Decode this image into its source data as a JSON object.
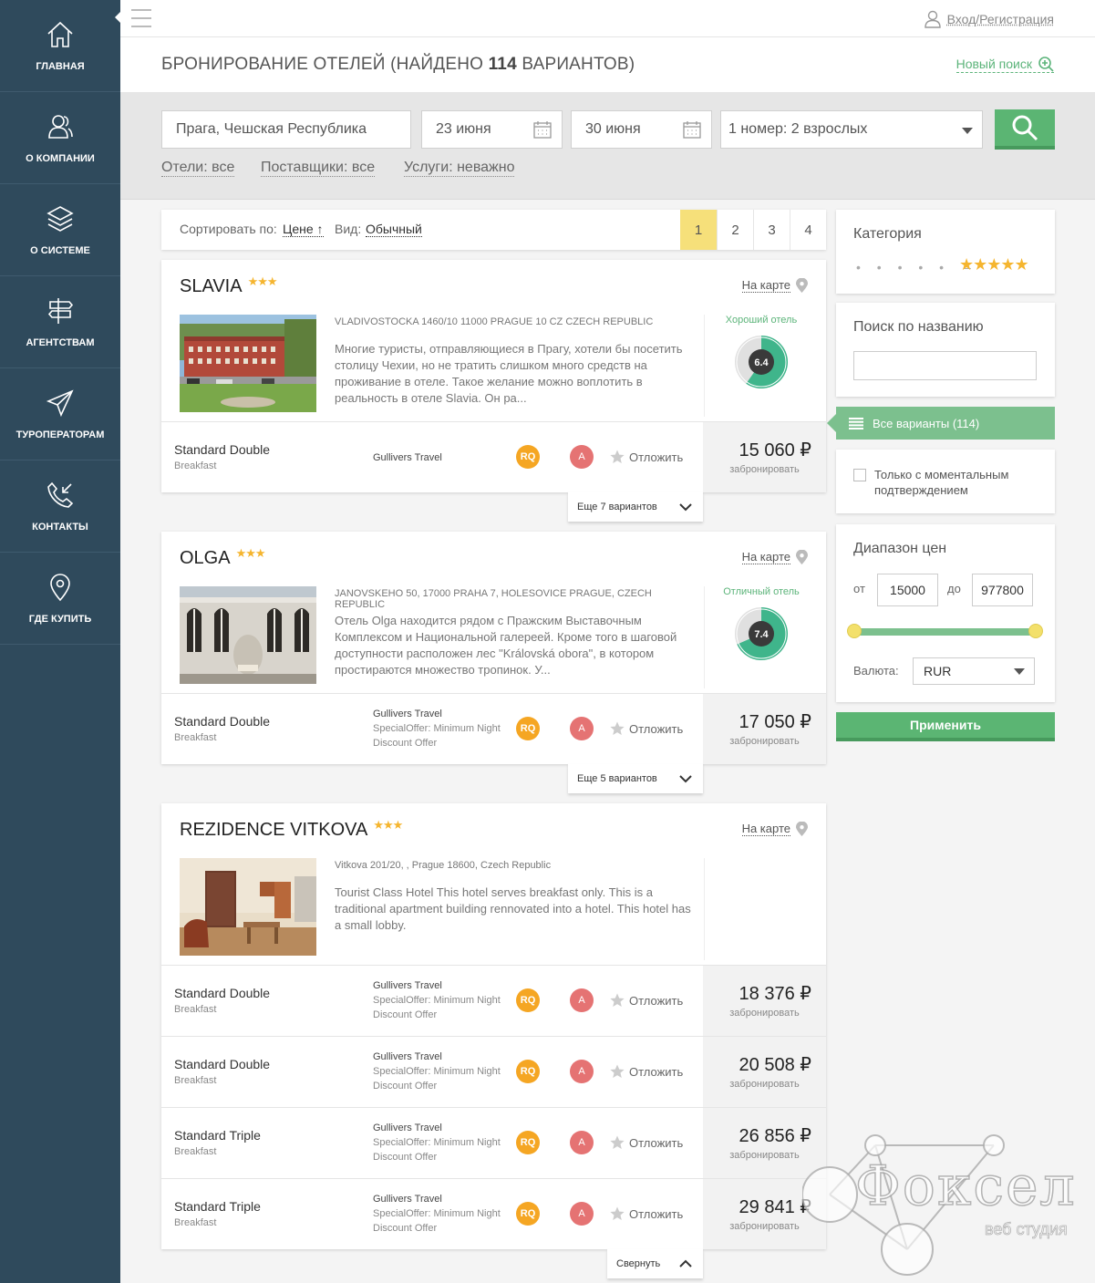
{
  "nav": {
    "items": [
      {
        "label": "ГЛАВНАЯ",
        "icon": "home-icon"
      },
      {
        "label": "О КОМПАНИИ",
        "icon": "users-icon"
      },
      {
        "label": "О СИСТЕМЕ",
        "icon": "layers-icon"
      },
      {
        "label": "АГЕНТСТВАМ",
        "icon": "signpost-icon"
      },
      {
        "label": "ТУРОПЕРАТОРАМ",
        "icon": "paper-plane-icon"
      },
      {
        "label": "КОНТАКТЫ",
        "icon": "phone-icon"
      },
      {
        "label": "ГДЕ КУПИТЬ",
        "icon": "map-pin-icon"
      }
    ]
  },
  "topbar": {
    "login": "Вход/Регистрация"
  },
  "header": {
    "title_prefix": "БРОНИРОВАНИЕ ОТЕЛЕЙ (НАЙДЕНО ",
    "title_count": "114",
    "title_suffix": " ВАРИАНТОВ)",
    "new_search": "Новый поиск"
  },
  "search": {
    "destination": "Прага, Чешская Республика",
    "checkin": "23 июня",
    "checkout": "30 июня",
    "guests": "1 номер: 2 взрослых",
    "filters": {
      "hotels": "Отели: все",
      "suppliers": "Поставщики: все",
      "services": "Услуги: неважно"
    }
  },
  "sort": {
    "label": "Сортировать по:",
    "value": "Цене ↑",
    "view_label": "Вид:",
    "view_value": "Обычный",
    "pages": [
      "1",
      "2",
      "3",
      "4"
    ],
    "current_page": "1"
  },
  "hotels": [
    {
      "name": "SLAVIA",
      "stars": "★★★",
      "map": "На карте",
      "address": "VLADIVOSTOCKA 1460/10 11000 PRAGUE 10 CZ CZECH REPUBLIC",
      "description": "Многие туристы, отправляющиеся в Прагу, хотели бы посетить столицу Чехии, но не тратить слишком много средств на проживание в отеле. Такое желание можно воплотить в реальность в отеле Slavia. Он ра...",
      "rating_label": "Хороший отель",
      "rating": "6.4",
      "offers": [
        {
          "room": "Standard Double",
          "meal": "Breakfast",
          "supplier": "Gullivers Travel",
          "special_1": "",
          "special_2": "",
          "rq": "RQ",
          "a": "A",
          "postpone": "Отложить",
          "price": "15 060 ₽",
          "book": "забронировать"
        }
      ],
      "more": "Еще 7 вариантов"
    },
    {
      "name": "OLGA",
      "stars": "★★★",
      "map": "На карте",
      "address": "JANOVSKEHO 50, 17000 PRAHA 7, HOLESOVICE PRAGUE, CZECH REPUBLIC",
      "description": "Отель Olga находится рядом с Пражским Выставочным Комплексом и Национальной галереей. Кроме того в шаговой доступности расположен лес \"Královská obora\", в котором простираются множество тропинок. У...",
      "rating_label": "Отличный отель",
      "rating": "7.4",
      "offers": [
        {
          "room": "Standard Double",
          "meal": "Breakfast",
          "supplier": "Gullivers Travel",
          "special_1": "SpecialOffer: Minimum Night",
          "special_2": "Discount Offer",
          "rq": "RQ",
          "a": "A",
          "postpone": "Отложить",
          "price": "17 050 ₽",
          "book": "забронировать"
        }
      ],
      "more": "Еще 5 вариантов"
    },
    {
      "name": "REZIDENCE VITKOVA",
      "stars": "★★★",
      "map": "На карте",
      "address": "Vitkova 201/20, , Prague 18600, Czech Republic",
      "description": "Tourist Class Hotel This hotel serves breakfast only. This is a traditional apartment building rennovated into a hotel. This hotel has a small lobby.",
      "offers": [
        {
          "room": "Standard Double",
          "meal": "Breakfast",
          "supplier": "Gullivers Travel",
          "special_1": "SpecialOffer: Minimum Night",
          "special_2": "Discount Offer",
          "rq": "RQ",
          "a": "A",
          "postpone": "Отложить",
          "price": "18 376 ₽",
          "book": "забронировать"
        },
        {
          "room": "Standard Double",
          "meal": "Breakfast",
          "supplier": "Gullivers Travel",
          "special_1": "SpecialOffer: Minimum Night",
          "special_2": "Discount Offer",
          "rq": "RQ",
          "a": "A",
          "postpone": "Отложить",
          "price": "20 508 ₽",
          "book": "забронировать"
        },
        {
          "room": "Standard Triple",
          "meal": "Breakfast",
          "supplier": "Gullivers Travel",
          "special_1": "SpecialOffer: Minimum Night",
          "special_2": "Discount Offer",
          "rq": "RQ",
          "a": "A",
          "postpone": "Отложить",
          "price": "26 856 ₽",
          "book": "забронировать"
        },
        {
          "room": "Standard Triple",
          "meal": "Breakfast",
          "supplier": "Gullivers Travel",
          "special_1": "SpecialOffer: Minimum Night",
          "special_2": "Discount Offer",
          "rq": "RQ",
          "a": "A",
          "postpone": "Отложить",
          "price": "29 841 ₽",
          "book": "забронировать"
        }
      ],
      "more": "Свернуть"
    }
  ],
  "filters_panel": {
    "category_title": "Категория",
    "category_dots": "• • • • •",
    "category_dash": "–",
    "category_stars": "★★★★★",
    "name_search_title": "Поиск по названию",
    "all_variants": "Все варианты (114)",
    "instant_label": "Только с моментальным подтверждением",
    "price_range_title": "Диапазон цен",
    "from_label": "от",
    "from_value": "15000",
    "to_label": "до",
    "to_value": "977800",
    "currency_label": "Валюта:",
    "currency_value": "RUR",
    "apply": "Применить"
  },
  "watermark": {
    "title": "Фоксел",
    "subtitle": "веб студия"
  },
  "colors": {
    "sidebar": "#2f4a5c",
    "accent_green": "#5bb573",
    "star": "#f5b52f",
    "active_page": "#f6e07a",
    "rq_badge": "#f5a623",
    "a_badge": "#e57373"
  }
}
